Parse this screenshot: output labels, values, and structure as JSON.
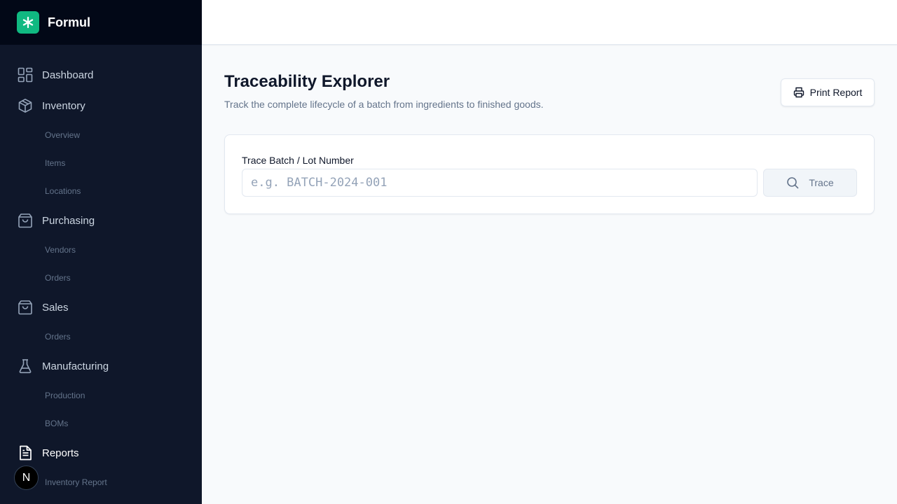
{
  "app": {
    "name": "Formul",
    "brand_color": "#10b981"
  },
  "sidebar": {
    "items": [
      {
        "label": "Dashboard",
        "icon": "grid-icon"
      },
      {
        "label": "Inventory",
        "icon": "box-icon",
        "children": [
          "Overview",
          "Items",
          "Locations"
        ]
      },
      {
        "label": "Purchasing",
        "icon": "shopping-bag-icon",
        "children": [
          "Vendors",
          "Orders"
        ]
      },
      {
        "label": "Sales",
        "icon": "shopping-bag-icon",
        "children": [
          "Orders"
        ]
      },
      {
        "label": "Manufacturing",
        "icon": "flask-icon",
        "children": [
          "Production",
          "BOMs"
        ]
      },
      {
        "label": "Reports",
        "icon": "file-text-icon",
        "active": true,
        "children": [
          "Inventory Report"
        ]
      }
    ],
    "avatar_initial": "N"
  },
  "page": {
    "title": "Traceability Explorer",
    "subtitle": "Track the complete lifecycle of a batch from ingredients to finished goods.",
    "print_label": "Print Report"
  },
  "trace_form": {
    "label": "Trace Batch / Lot Number",
    "placeholder": "e.g. BATCH-2024-001",
    "value": "",
    "button_label": "Trace"
  }
}
